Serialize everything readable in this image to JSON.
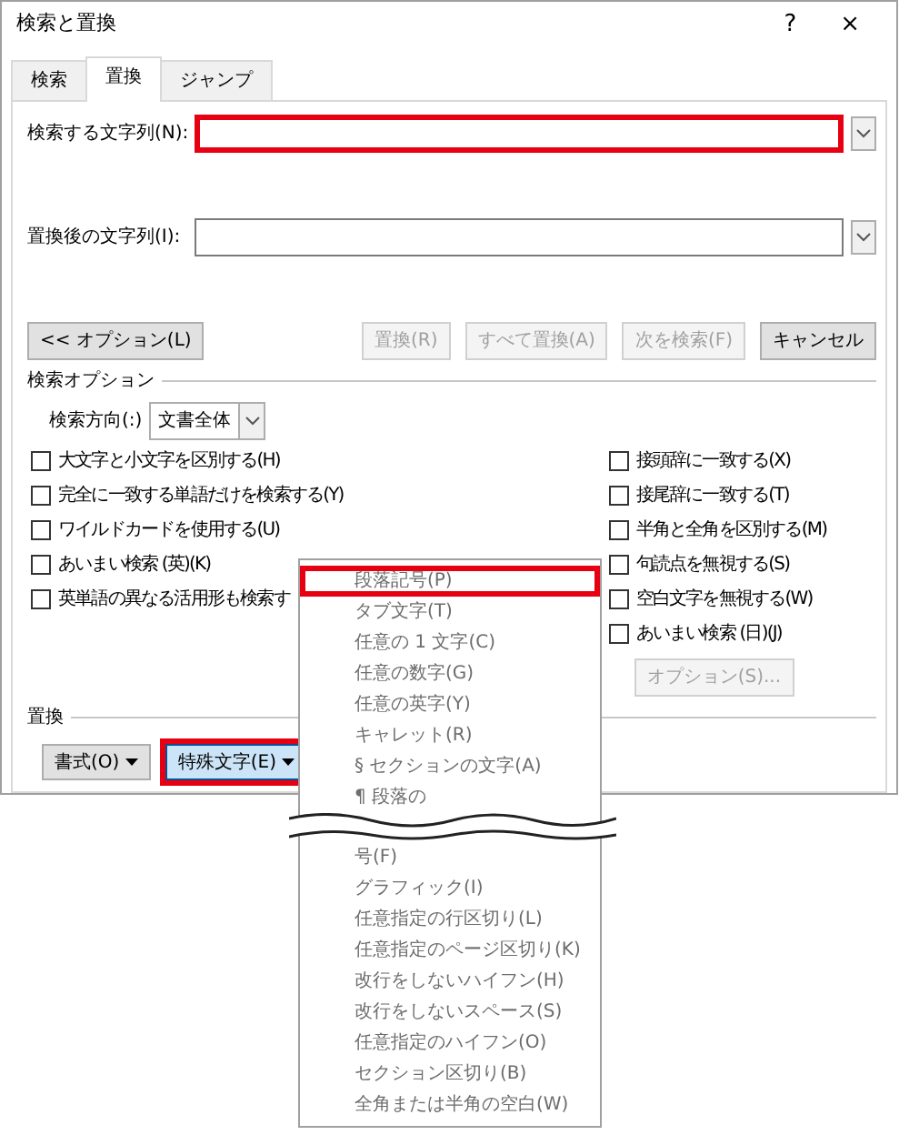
{
  "window": {
    "title": "検索と置換",
    "help": "?",
    "close": "×"
  },
  "tabs": [
    {
      "label": "検索",
      "selected": false
    },
    {
      "label": "置換",
      "selected": true
    },
    {
      "label": "ジャンプ",
      "selected": false
    }
  ],
  "find": {
    "label": "検索する文字列(N):",
    "highlighted": true
  },
  "replace": {
    "label": "置換後の文字列(I):",
    "highlighted": false
  },
  "buttons": [
    {
      "label": "<< オプション(L)",
      "disabled": false
    },
    {
      "label": "置換(R)",
      "disabled": true
    },
    {
      "label": "すべて置換(A)",
      "disabled": true
    },
    {
      "label": "次を検索(F)",
      "disabled": true
    },
    {
      "label": "キャンセル",
      "disabled": false
    }
  ],
  "search_options": {
    "heading": "検索オプション",
    "direction_label": "検索方向(:)",
    "direction_value": "文書全体",
    "left": [
      {
        "label": "大文字と小文字を区別する(H)",
        "checked": false
      },
      {
        "label": "完全に一致する単語だけを検索する(Y)",
        "checked": false
      },
      {
        "label": "ワイルドカードを使用する(U)",
        "checked": false
      },
      {
        "label": "あいまい検索 (英)(K)",
        "checked": false
      },
      {
        "label": "英単語の異なる活用形も検索す",
        "checked": false
      }
    ],
    "right": [
      {
        "label": "接頭辞に一致する(X)",
        "checked": false
      },
      {
        "label": "接尾辞に一致する(T)",
        "checked": false
      },
      {
        "label": "半角と全角を区別する(M)",
        "checked": false
      },
      {
        "label": "句読点を無視する(S)",
        "checked": false
      },
      {
        "label": "空白文字を無視する(W)",
        "checked": false
      },
      {
        "label": "あいまい検索 (日)(J)",
        "checked": false
      }
    ],
    "options_button": {
      "label": "オプション(S)...",
      "disabled": true
    }
  },
  "replace_section": {
    "heading": "置換",
    "buttons": [
      {
        "label": "書式(O)",
        "highlighted": false
      },
      {
        "label": "特殊文字(E)",
        "highlighted": true
      }
    ]
  },
  "menu": {
    "items": [
      {
        "kind": "item",
        "label": "段落記号(P)",
        "highlighted": true
      },
      {
        "kind": "item",
        "label": "タブ文字(T)",
        "highlighted": false
      },
      {
        "kind": "item",
        "label": "任意の 1 文字(C)",
        "highlighted": false
      },
      {
        "kind": "item",
        "label": "任意の数字(G)",
        "highlighted": false
      },
      {
        "kind": "item",
        "label": "任意の英字(Y)",
        "highlighted": false
      },
      {
        "kind": "item",
        "label": "キャレット(R)",
        "highlighted": false
      },
      {
        "kind": "item",
        "label": "§ セクションの文字(A)",
        "highlighted": false
      },
      {
        "kind": "item",
        "label": "¶ 段落の",
        "highlighted": false
      },
      {
        "kind": "break"
      },
      {
        "kind": "item",
        "label": "号(F)",
        "highlighted": false
      },
      {
        "kind": "item",
        "label": "グラフィック(I)",
        "highlighted": false
      },
      {
        "kind": "item",
        "label": "任意指定の行区切り(L)",
        "highlighted": false
      },
      {
        "kind": "item",
        "label": "任意指定のページ区切り(K)",
        "highlighted": false
      },
      {
        "kind": "item",
        "label": "改行をしないハイフン(H)",
        "highlighted": false
      },
      {
        "kind": "item",
        "label": "改行をしないスペース(S)",
        "highlighted": false
      },
      {
        "kind": "item",
        "label": "任意指定のハイフン(O)",
        "highlighted": false
      },
      {
        "kind": "item",
        "label": "セクション区切り(B)",
        "highlighted": false
      },
      {
        "kind": "item",
        "label": "全角または半角の空白(W)",
        "highlighted": false
      }
    ]
  }
}
